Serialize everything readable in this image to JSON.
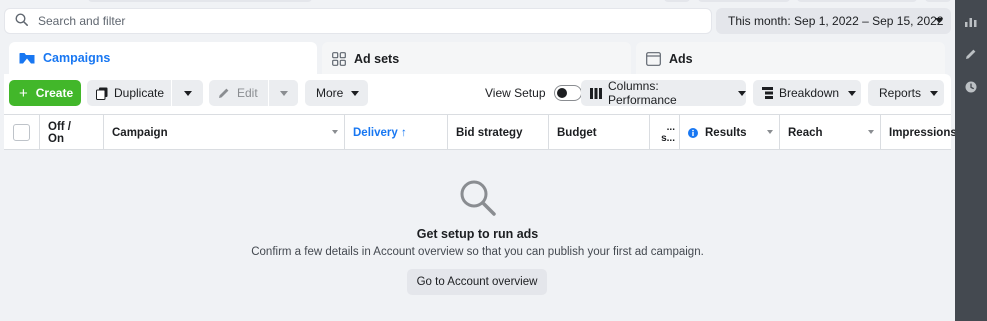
{
  "search": {
    "placeholder": "Search and filter"
  },
  "date_range": {
    "label": "This month: Sep 1, 2022 – Sep 15, 2022"
  },
  "tabs": [
    {
      "label": "Campaigns",
      "icon": "folder-icon",
      "active": true
    },
    {
      "label": "Ad sets",
      "icon": "grid-icon",
      "active": false
    },
    {
      "label": "Ads",
      "icon": "ad-icon",
      "active": false
    }
  ],
  "toolbar": {
    "create_label": "Create",
    "duplicate_label": "Duplicate",
    "edit_label": "Edit",
    "more_label": "More",
    "view_setup_label": "View Setup",
    "columns_label": "Columns: Performance",
    "breakdown_label": "Breakdown",
    "reports_label": "Reports"
  },
  "table": {
    "columns": [
      {
        "label": "Off / On"
      },
      {
        "label": "Campaign"
      },
      {
        "label": "Delivery ↑"
      },
      {
        "label": "Bid strategy"
      },
      {
        "label": "Budget"
      },
      {
        "label": "... s..."
      },
      {
        "label": "Results"
      },
      {
        "label": "Reach"
      },
      {
        "label": "Impressions"
      }
    ]
  },
  "empty_state": {
    "title": "Get setup to run ads",
    "description": "Confirm a few details in Account overview so that you can publish your first ad campaign.",
    "button_label": "Go to Account overview"
  },
  "colors": {
    "accent": "#1877f2",
    "create": "#42b72a",
    "background": "#f0f2f5",
    "sidebar": "#444950"
  }
}
